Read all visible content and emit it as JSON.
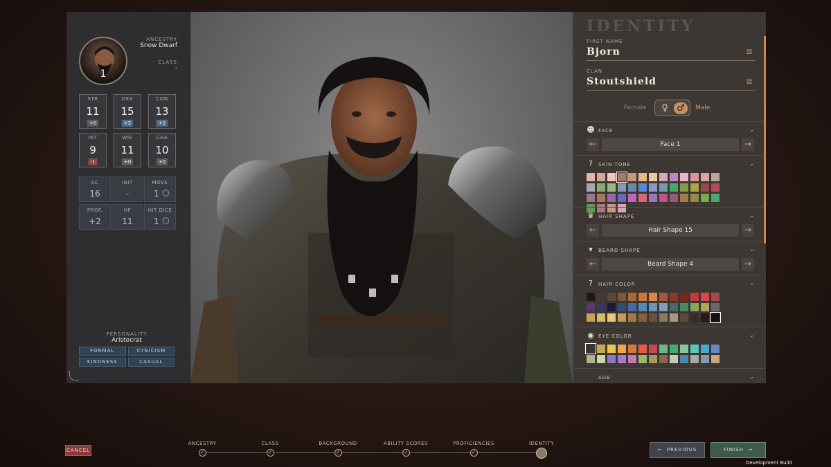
{
  "character": {
    "level": "1",
    "ancestry_label": "ANCESTRY",
    "ancestry": "Snow Dwarf",
    "class_label": "CLASS",
    "class": "-"
  },
  "abilities": [
    {
      "key": "STR",
      "value": "11",
      "mod": "+0",
      "kind": "zero"
    },
    {
      "key": "DEX",
      "value": "15",
      "mod": "+2",
      "kind": "pos"
    },
    {
      "key": "CON",
      "value": "13",
      "mod": "+1",
      "kind": "pos"
    },
    {
      "key": "INT",
      "value": "9",
      "mod": "-1",
      "kind": "neg"
    },
    {
      "key": "WIS",
      "value": "11",
      "mod": "+0",
      "kind": "zero"
    },
    {
      "key": "CHA",
      "value": "10",
      "mod": "+0",
      "kind": "zero"
    }
  ],
  "combat": [
    {
      "key": "AC",
      "value": "16"
    },
    {
      "key": "INIT",
      "value": "-"
    },
    {
      "key": "MOVE",
      "value": "1"
    },
    {
      "key": "PROF.",
      "value": "+2"
    },
    {
      "key": "HP",
      "value": "11"
    },
    {
      "key": "HIT DICE",
      "value": "1"
    }
  ],
  "personality": {
    "label": "PERSONALITY",
    "value": "Aristocrat",
    "tags": [
      "FORMAL",
      "CYNICISM",
      "KINDNESS",
      "CASUAL"
    ]
  },
  "identity": {
    "title": "IDENTITY",
    "first_name_label": "FIRST NAME",
    "first_name": "Bjorn",
    "clan_label": "CLAN",
    "clan": "Stoutshield",
    "female_label": "Female",
    "male_label": "Male",
    "female_symbol": "♀",
    "male_symbol": "♂"
  },
  "appearance": {
    "face": {
      "label": "FACE",
      "value": "Face 1"
    },
    "skin_tone": {
      "label": "SKIN TONE"
    },
    "hair_shape": {
      "label": "HAIR SHAPE",
      "value": "Hair Shape 15"
    },
    "beard_shape": {
      "label": "BEARD SHAPE",
      "value": "Beard Shape 4"
    },
    "hair_color": {
      "label": "HAIR COLOR"
    },
    "eye_color": {
      "label": "EYE COLOR"
    },
    "next_label": "AGE"
  },
  "palettes": {
    "skin": [
      "#e0b8a8",
      "#d8a894",
      "#f0c8b8",
      "#a87868",
      "#c89878",
      "#e8b888",
      "#e8c8a0",
      "#d8a8b8",
      "#b888c8",
      "#e8b8c8",
      "#d89898",
      "#d8a8a0",
      "#b8a8a0",
      "#a8a8a8",
      "#88a878",
      "#98b888",
      "#8898b8",
      "#6888a8",
      "#5888d8",
      "#8898c8",
      "#7898a8",
      "#48a868",
      "#889848",
      "#a8a848",
      "#984848",
      "#b84858",
      "#987888",
      "#a87858",
      "#9868a8",
      "#6868c8",
      "#b868b8",
      "#d86878",
      "#9878b8",
      "#b85888",
      "#985878",
      "#a87848",
      "#988848",
      "#78a848",
      "#48a878",
      "#689858",
      "#a87888",
      "#c89888",
      "#d8a8b8"
    ],
    "hair": [
      "#201818",
      "#483a30",
      "#5a4838",
      "#7a5838",
      "#a86838",
      "#c87838",
      "#d88848",
      "#a85838",
      "#883828",
      "#782818",
      "#c83838",
      "#d84848",
      "#a84848",
      "#5a3868",
      "#3a3858",
      "#1a1a30",
      "#3a4878",
      "#4868a8",
      "#5888b8",
      "#6898b8",
      "#889ab8",
      "#48686a",
      "#488868",
      "#88a858",
      "#a8a858",
      "#6a6a6a",
      "#c8a058",
      "#d8b868",
      "#e8c878",
      "#c89858",
      "#a87848",
      "#8a6038",
      "#6a5040",
      "#8a7860",
      "#a89880",
      "#5a4a40",
      "#3a2a28",
      "#281818",
      "#181010"
    ],
    "eye": [
      "#3a3430",
      "#c8a848",
      "#e8c848",
      "#e8a848",
      "#d87838",
      "#e85848",
      "#c84858",
      "#68b888",
      "#48a878",
      "#88c898",
      "#58c8b8",
      "#48a8c8",
      "#6888c8",
      "#a8b888",
      "#c8d8a8",
      "#8a78c8",
      "#a878c8",
      "#c878b8",
      "#98b868",
      "#a89858",
      "#886848",
      "#c8c8b8",
      "#4888a8",
      "#a8a8a8",
      "#8898a8",
      "#c8a878"
    ]
  },
  "steps": [
    {
      "label": "ANCESTRY",
      "state": "done"
    },
    {
      "label": "CLASS",
      "state": "done"
    },
    {
      "label": "BACKGROUND",
      "state": "done"
    },
    {
      "label": "ABILITY SCORES",
      "state": "done"
    },
    {
      "label": "PROFICIENCIES",
      "state": "done"
    },
    {
      "label": "IDENTITY",
      "state": "active"
    }
  ],
  "buttons": {
    "cancel": "CANCEL",
    "previous": "PREVIOUS",
    "finish": "FINISH",
    "prev_arrow": "←",
    "next_arrow": "→",
    "check": "✓"
  },
  "build_label": "Development Build",
  "icons": [
    "dice-icon",
    "face-icon",
    "question-icon",
    "hair-icon",
    "beard-icon",
    "eye-icon",
    "chevron-down-icon",
    "cube-icon"
  ]
}
